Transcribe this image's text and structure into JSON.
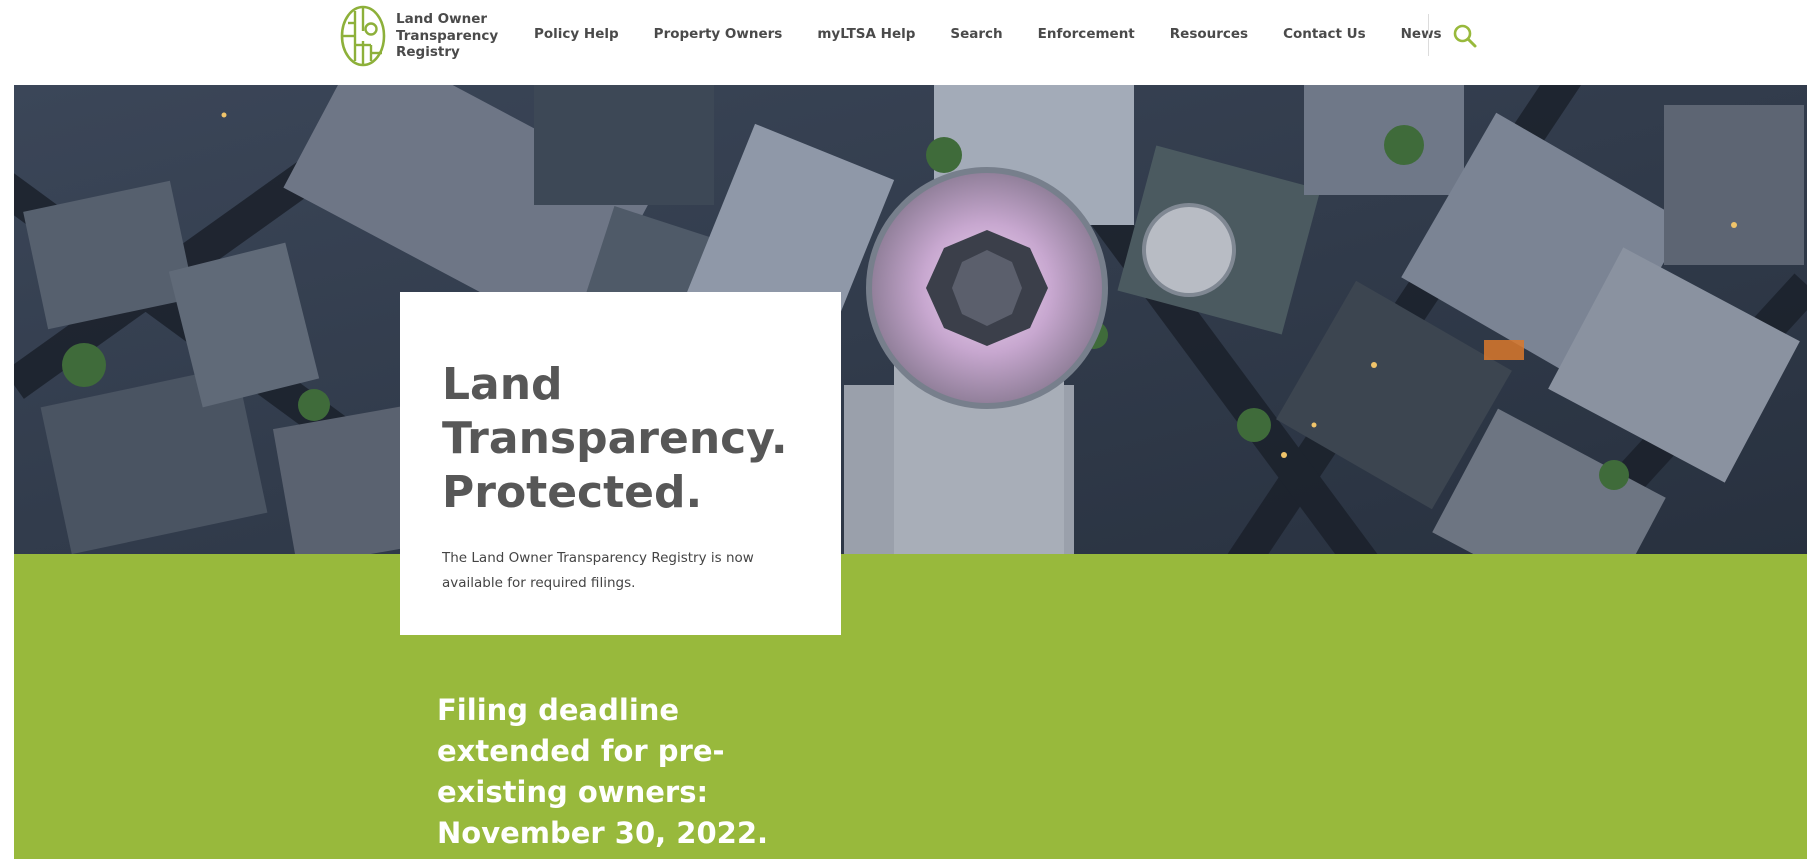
{
  "header": {
    "logo_lines": [
      "Land Owner",
      "Transparency",
      "Registry"
    ],
    "nav": [
      {
        "label": "Policy Help",
        "name": "nav-policy-help"
      },
      {
        "label": "Property Owners",
        "name": "nav-property-owners"
      },
      {
        "label": "myLTSA Help",
        "name": "nav-myltsa-help"
      },
      {
        "label": "Search",
        "name": "nav-search"
      },
      {
        "label": "Enforcement",
        "name": "nav-enforcement"
      },
      {
        "label": "Resources",
        "name": "nav-resources"
      },
      {
        "label": "Contact Us",
        "name": "nav-contact-us"
      },
      {
        "label": "News",
        "name": "nav-news"
      }
    ],
    "search_icon": "search-icon"
  },
  "hero": {
    "image": "aerial-city-photo",
    "title_lines": [
      "Land",
      "Transparency.",
      "Protected."
    ],
    "description": "The Land Owner Transparency Registry is now available for required filings."
  },
  "announcement": {
    "lines": [
      "Filing deadline",
      "extended for pre-",
      "existing owners:",
      "November 30, 2022."
    ]
  },
  "colors": {
    "brand_green": "#98b93c",
    "text_dark": "#4a4a4a",
    "title_gray": "#575757"
  }
}
